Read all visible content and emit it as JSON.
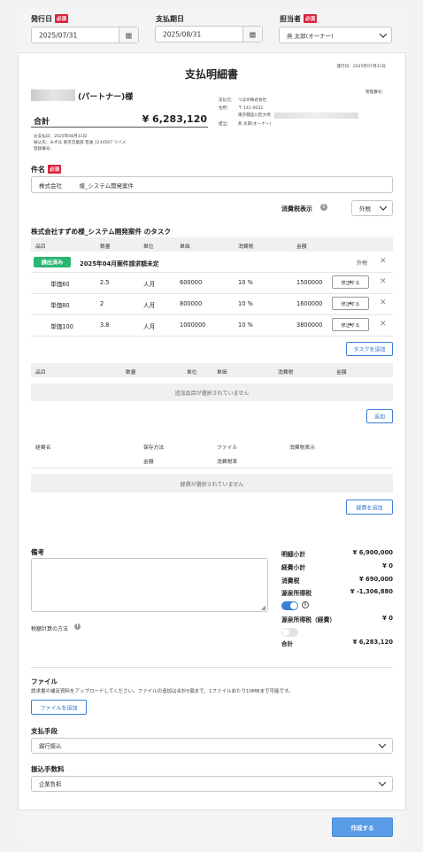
{
  "header": {
    "issue_date": {
      "label": "発行日",
      "required": "必須",
      "value": "2025/07/31"
    },
    "due_date": {
      "label": "支払期日",
      "value": "2025/08/31"
    },
    "assignee": {
      "label": "担当者",
      "required": "必須",
      "value": "燕 太郎(オーナー)"
    },
    "calendar_icon": "▦"
  },
  "doc": {
    "title": "支払明細書",
    "issued_line": "発行日：2025年07月31日",
    "mgmt_no": "管理番号：",
    "partner_suffix": "(パートナー)様",
    "total_label": "合計",
    "total_value": "¥ 6,283,120",
    "pay_info": [
      "お支払日：2025年08月31日",
      "振込先：みずほ 東京営業部 普通 1234567 ツバメ",
      "登録番号："
    ],
    "company": {
      "payer_label": "支払元：",
      "payer": "つばめ株式会社",
      "addr_label": "住所：",
      "postal": "〒 141-0032",
      "addr": "東京都品川区大崎",
      "person_label": "担当：",
      "person": "燕 太郎(オーナー)"
    }
  },
  "subject": {
    "label": "件名",
    "required": "必須",
    "value": "株式会社　　　様_システム開発案件"
  },
  "tax_display": {
    "label": "消費税表示",
    "value": "外税"
  },
  "task_section": {
    "title": "株式会社すずめ様_システム開発案件 のタスク",
    "headers": [
      "品目",
      "数量",
      "単位",
      "単価",
      "消費税",
      "金額"
    ],
    "group": {
      "badge": "請出済み",
      "name": "2025年04月案件請求額未定",
      "tax": "外税"
    },
    "rows": [
      {
        "item": "単価60",
        "qty": "2.5",
        "unit": "人月",
        "price": "600000",
        "tax": "10 %",
        "amount": "1500000",
        "action": "修正する"
      },
      {
        "item": "単価80",
        "qty": "2",
        "unit": "人月",
        "price": "800000",
        "tax": "10 %",
        "amount": "1600000",
        "action": "修正する"
      },
      {
        "item": "単価100",
        "qty": "3.8",
        "unit": "人月",
        "price": "1000000",
        "tax": "10 %",
        "amount": "3800000",
        "action": "修正する"
      }
    ],
    "add_task": "タスクを追加"
  },
  "items_section": {
    "headers": [
      "品目",
      "数量",
      "単位",
      "単価",
      "消費税",
      "金額"
    ],
    "empty": "追加品目が選択されていません",
    "add": "追加"
  },
  "expense_section": {
    "headers": [
      "経費名",
      "保存方法",
      "ファイル",
      "消費税表示",
      "金額",
      "消費税率"
    ],
    "empty": "経費が選択されていません",
    "add": "経費を追加"
  },
  "notes": {
    "label": "備考",
    "tax_calc_label": "税額計算の方法"
  },
  "summary": {
    "rows": [
      {
        "label": "明細小計",
        "value": "¥ 6,900,000"
      },
      {
        "label": "経費小計",
        "value": "¥ 0"
      },
      {
        "label": "消費税",
        "value": "¥ 690,000"
      },
      {
        "label": "源泉所得税",
        "value": "¥ -1,306,880"
      }
    ],
    "withholding_exp": {
      "label": "源泉所得税（経費）",
      "value": "¥ 0"
    },
    "total": {
      "label": "合計",
      "value": "¥ 6,283,120"
    },
    "toggle1_on": true,
    "toggle2_on": false
  },
  "files": {
    "label": "ファイル",
    "desc": "請求書の補足資料をアップロードしてください。ファイルの追加は合計5個まで、1ファイルあたり10MBまで可能です。",
    "add": "ファイルを追加"
  },
  "payment_method": {
    "label": "支払手段",
    "value": "銀行振込"
  },
  "transfer_fee": {
    "label": "振込手数料",
    "value": "企業負担"
  },
  "submit": "作成する",
  "colors": {
    "accent": "#3b7dd8",
    "required": "#d7263d",
    "badge": "#2bb673",
    "submit": "#5a9de6"
  }
}
